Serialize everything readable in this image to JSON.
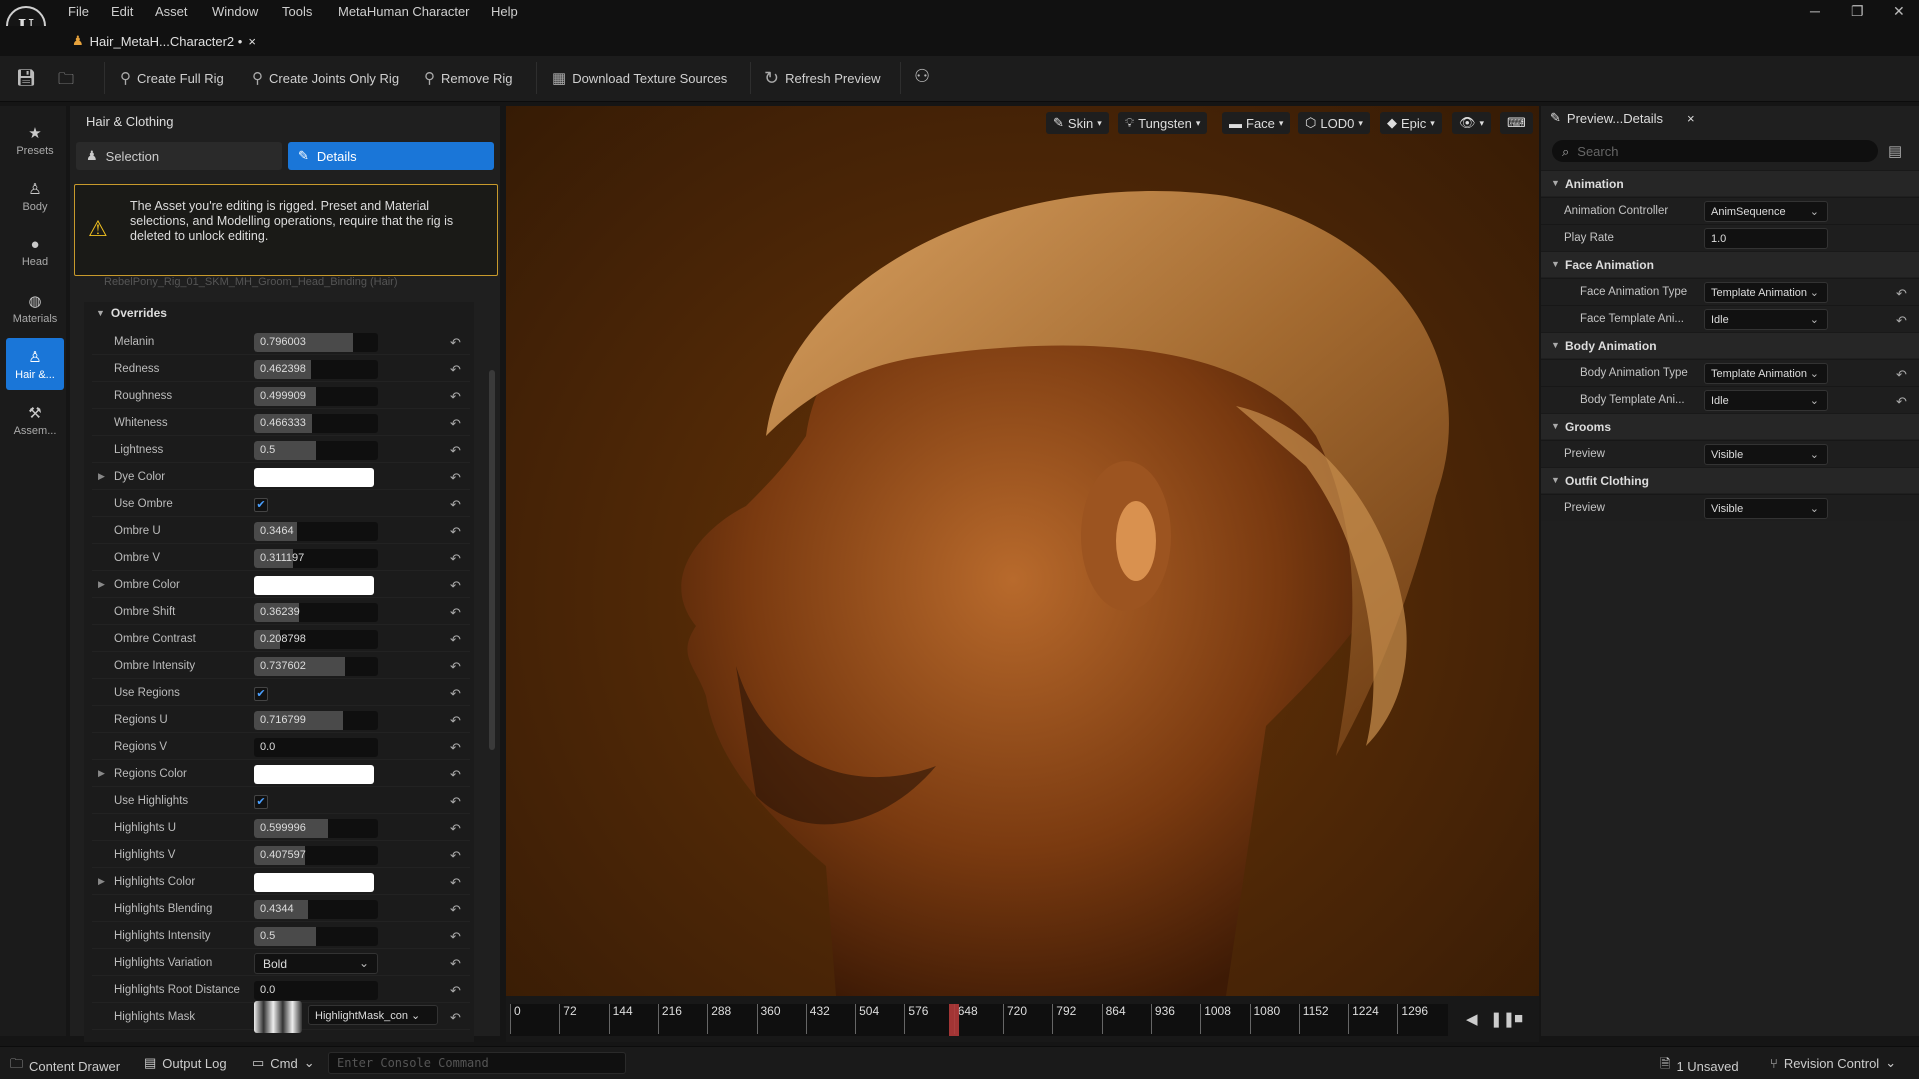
{
  "app": {
    "logo_text": "U"
  },
  "menu": [
    "File",
    "Edit",
    "Asset",
    "Window",
    "Tools",
    "MetaHuman Character",
    "Help"
  ],
  "document_tab": {
    "title": "Hair_MetaH...Character2 •",
    "close": "×"
  },
  "toolbar": {
    "create_full_rig": "Create Full Rig",
    "create_joints_only_rig": "Create Joints Only Rig",
    "remove_rig": "Remove Rig",
    "download_texture_sources": "Download Texture Sources",
    "refresh_preview": "Refresh Preview"
  },
  "left_rail": [
    {
      "label": "Presets",
      "icon": "star-icon"
    },
    {
      "label": "Body",
      "icon": "body-icon"
    },
    {
      "label": "Head",
      "icon": "head-icon"
    },
    {
      "label": "Materials",
      "icon": "materials-icon"
    },
    {
      "label": "Hair &...",
      "icon": "hair-icon",
      "active": true
    },
    {
      "label": "Assem...",
      "icon": "hammer-icon"
    }
  ],
  "panel": {
    "title": "Hair & Clothing",
    "tab_selection": "Selection",
    "tab_details": "Details",
    "warning": "The Asset you're editing is rigged. Preset and Material selections, and Modelling operations, require that the rig is deleted to unlock editing.",
    "clipped_row": "RebelPony_Rig_01_SKM_MH_Groom_Head_Binding (Hair)",
    "overrides_label": "Overrides",
    "properties": [
      {
        "label": "Melanin",
        "type": "number",
        "value": "0.796003",
        "fill": 0.796003
      },
      {
        "label": "Redness",
        "type": "number",
        "value": "0.462398",
        "fill": 0.462398
      },
      {
        "label": "Roughness",
        "type": "number",
        "value": "0.499909",
        "fill": 0.499909
      },
      {
        "label": "Whiteness",
        "type": "number",
        "value": "0.466333",
        "fill": 0.466333
      },
      {
        "label": "Lightness",
        "type": "number",
        "value": "0.5",
        "fill": 0.5
      },
      {
        "label": "Dye Color",
        "type": "color",
        "expandable": true
      },
      {
        "label": "Use Ombre",
        "type": "check",
        "checked": true
      },
      {
        "label": "Ombre U",
        "type": "number",
        "value": "0.3464",
        "fill": 0.3464
      },
      {
        "label": "Ombre V",
        "type": "number",
        "value": "0.311197",
        "fill": 0.311197
      },
      {
        "label": "Ombre Color",
        "type": "color",
        "expandable": true
      },
      {
        "label": "Ombre Shift",
        "type": "number",
        "value": "0.36239",
        "fill": 0.36239
      },
      {
        "label": "Ombre Contrast",
        "type": "number",
        "value": "0.208798",
        "fill": 0.208798
      },
      {
        "label": "Ombre Intensity",
        "type": "number",
        "value": "0.737602",
        "fill": 0.737602
      },
      {
        "label": "Use Regions",
        "type": "check",
        "checked": true
      },
      {
        "label": "Regions U",
        "type": "number",
        "value": "0.716799",
        "fill": 0.716799
      },
      {
        "label": "Regions V",
        "type": "number",
        "value": "0.0",
        "fill": 0
      },
      {
        "label": "Regions Color",
        "type": "color",
        "expandable": true
      },
      {
        "label": "Use Highlights",
        "type": "check",
        "checked": true
      },
      {
        "label": "Highlights U",
        "type": "number",
        "value": "0.599996",
        "fill": 0.599996
      },
      {
        "label": "Highlights V",
        "type": "number",
        "value": "0.407597",
        "fill": 0.407597
      },
      {
        "label": "Highlights Color",
        "type": "color",
        "expandable": true
      },
      {
        "label": "Highlights Blending",
        "type": "number",
        "value": "0.4344",
        "fill": 0.4344
      },
      {
        "label": "Highlights Intensity",
        "type": "number",
        "value": "0.5",
        "fill": 0.5
      },
      {
        "label": "Highlights Variation",
        "type": "select",
        "value": "Bold"
      },
      {
        "label": "Highlights Root Distance",
        "type": "number",
        "value": "0.0",
        "fill": 0
      },
      {
        "label": "Highlights Mask",
        "type": "mask",
        "value": "HighlightMask_con"
      }
    ]
  },
  "viewport": {
    "buttons": [
      "Skin",
      "Tungsten",
      "Face",
      "LOD0",
      "Epic"
    ]
  },
  "timeline": {
    "ticks": [
      "0",
      "72",
      "144",
      "216",
      "288",
      "360",
      "432",
      "504",
      "576",
      "648",
      "720",
      "792",
      "864",
      "936",
      "1008",
      "1080",
      "1152",
      "1224",
      "1296"
    ]
  },
  "details": {
    "tab_title": "Preview...Details",
    "search_placeholder": "Search",
    "sections": [
      {
        "title": "Animation",
        "rows": [
          {
            "label": "Animation Controller",
            "value": "AnimSequence",
            "kind": "select"
          },
          {
            "label": "Play Rate",
            "value": "1.0",
            "kind": "input"
          }
        ]
      },
      {
        "title": "Face Animation",
        "rows": [
          {
            "label": "Face Animation Type",
            "value": "Template Animation",
            "kind": "select",
            "reset": true
          },
          {
            "label": "Face Template Ani...",
            "value": "Idle",
            "kind": "select",
            "reset": true
          }
        ]
      },
      {
        "title": "Body Animation",
        "rows": [
          {
            "label": "Body Animation Type",
            "value": "Template Animation",
            "kind": "select",
            "reset": true
          },
          {
            "label": "Body Template Ani...",
            "value": "Idle",
            "kind": "select",
            "reset": true
          }
        ]
      },
      {
        "title": "Grooms",
        "rows": [
          {
            "label": "Preview",
            "value": "Visible",
            "kind": "select"
          }
        ]
      },
      {
        "title": "Outfit Clothing",
        "rows": [
          {
            "label": "Preview",
            "value": "Visible",
            "kind": "select"
          }
        ]
      }
    ]
  },
  "status": {
    "content_drawer": "Content Drawer",
    "output_log": "Output Log",
    "cmd": "Cmd",
    "console_placeholder": "Enter Console Command",
    "unsaved": "1 Unsaved",
    "revision_control": "Revision Control"
  }
}
